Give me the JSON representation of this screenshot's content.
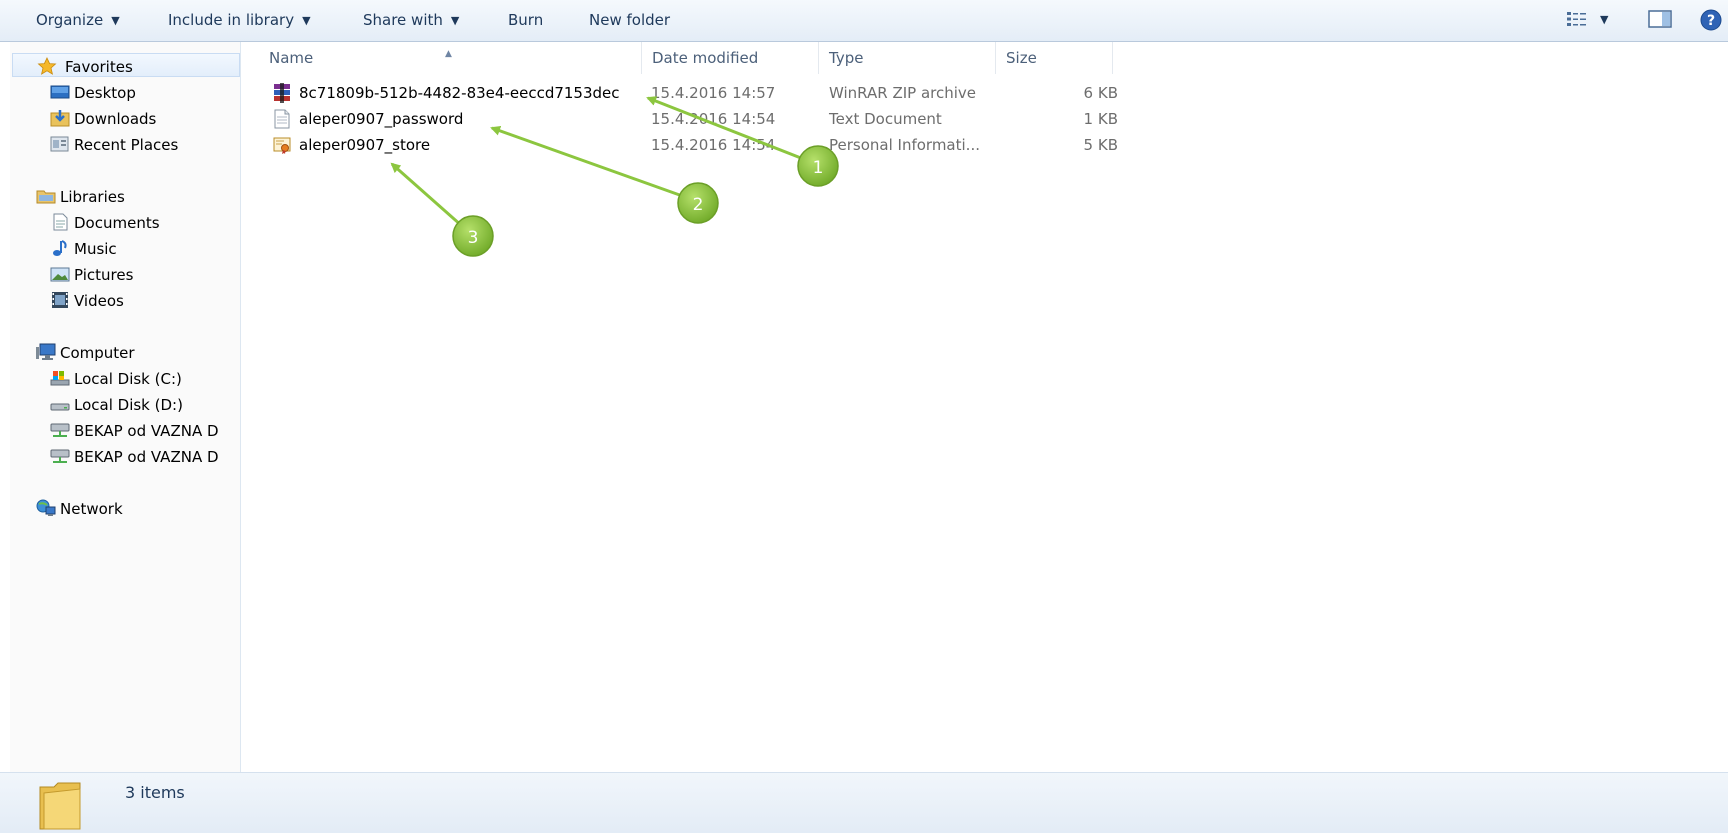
{
  "toolbar": {
    "organize": "Organize",
    "include_in_library": "Include in library",
    "share_with": "Share with",
    "burn": "Burn",
    "new_folder": "New folder",
    "right_icons": [
      "views-icon",
      "preview-pane-icon",
      "help-icon"
    ]
  },
  "nav": {
    "favorites": "Favorites",
    "desktop": "Desktop",
    "downloads": "Downloads",
    "recent_places": "Recent Places",
    "libraries": "Libraries",
    "documents": "Documents",
    "music": "Music",
    "pictures": "Pictures",
    "videos": "Videos",
    "computer": "Computer",
    "local_disk_c": "Local Disk (C:)",
    "local_disk_d": "Local Disk (D:)",
    "bekap_1": "BEKAP od VAZNA D",
    "bekap_2": "BEKAP od VAZNA D",
    "network": "Network"
  },
  "columns": {
    "name": "Name",
    "date_modified": "Date modified",
    "type": "Type",
    "size": "Size"
  },
  "files": [
    {
      "name": "8c71809b-512b-4482-83e4-eeccd7153dec",
      "date": "15.4.2016 14:57",
      "type": "WinRAR ZIP archive",
      "size": "6 KB",
      "icon": "winrar-archive-icon"
    },
    {
      "name": "aleper0907_password",
      "date": "15.4.2016 14:54",
      "type": "Text Document",
      "size": "1 KB",
      "icon": "text-document-icon"
    },
    {
      "name": "aleper0907_store",
      "date": "15.4.2016 14:54",
      "type": "Personal Informati...",
      "size": "5 KB",
      "icon": "certificate-icon"
    }
  ],
  "annotations": {
    "marker_1": "1",
    "marker_2": "2",
    "marker_3": "3",
    "color": "#8cc63f"
  },
  "status": {
    "item_count": "3 items"
  }
}
